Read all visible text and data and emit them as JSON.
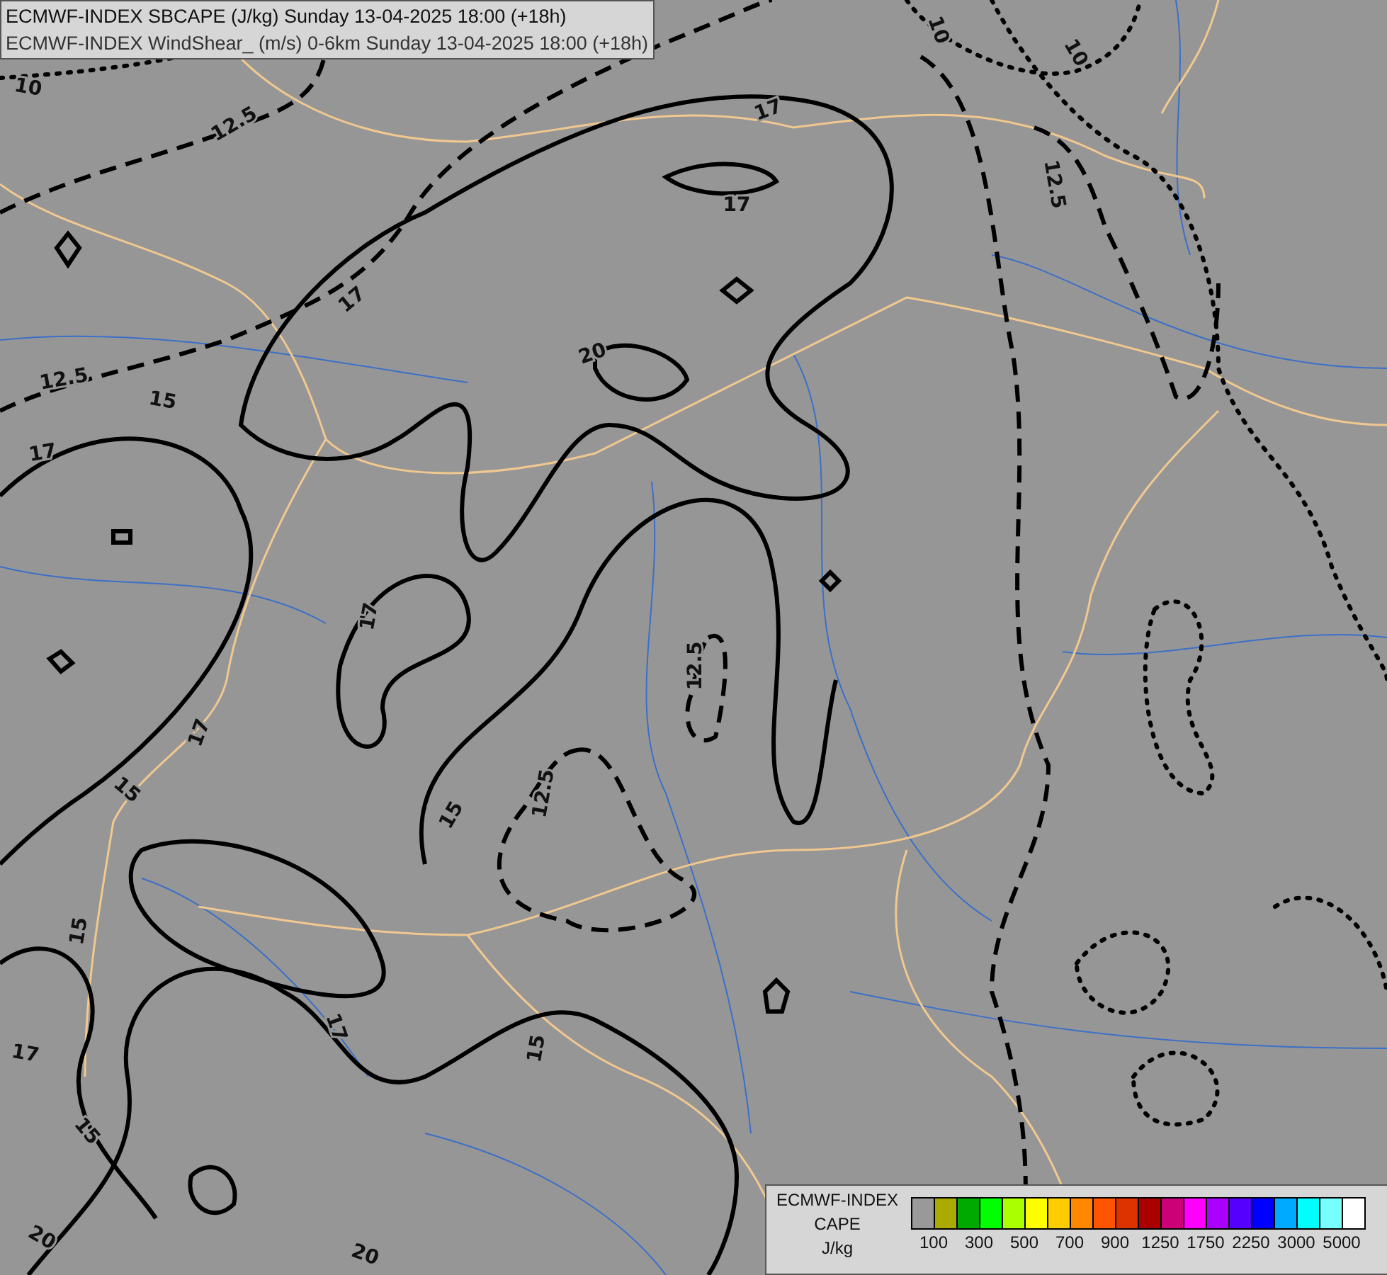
{
  "title_lines": [
    "ECMWF-INDEX SBCAPE (J/kg) Sunday 13-04-2025 18:00 (+18h)",
    "ECMWF-INDEX WindShear_ (m/s) 0-6km Sunday 13-04-2025 18:00 (+18h)"
  ],
  "map": {
    "contour_labels": [
      "10",
      "12.5",
      "10",
      "10",
      "17",
      "17",
      "12.5",
      "17",
      "20",
      "12.5",
      "15",
      "17",
      "17",
      "12.5",
      "17",
      "15",
      "12.5",
      "15",
      "15",
      "17",
      "15",
      "17",
      "15",
      "20",
      "20"
    ]
  },
  "legend": {
    "title_lines": [
      "ECMWF-INDEX",
      "CAPE",
      "J/kg"
    ],
    "swatches": [
      {
        "color": "#999999"
      },
      {
        "color": "#aaaa00"
      },
      {
        "color": "#00aa00"
      },
      {
        "color": "#00ff00"
      },
      {
        "color": "#aaff00"
      },
      {
        "color": "#ffff00"
      },
      {
        "color": "#ffcc00"
      },
      {
        "color": "#ff8800"
      },
      {
        "color": "#ff5500"
      },
      {
        "color": "#dd3300"
      },
      {
        "color": "#aa0000"
      },
      {
        "color": "#cc0077"
      },
      {
        "color": "#ff00ff"
      },
      {
        "color": "#aa00ff"
      },
      {
        "color": "#5500ff"
      },
      {
        "color": "#0000ff"
      },
      {
        "color": "#00aaff"
      },
      {
        "color": "#00ffff"
      },
      {
        "color": "#77ffff"
      },
      {
        "color": "#ffffff"
      }
    ],
    "tick_labels": [
      "100",
      "300",
      "500",
      "700",
      "900",
      "1250",
      "1750",
      "2250",
      "3000",
      "5000"
    ]
  }
}
